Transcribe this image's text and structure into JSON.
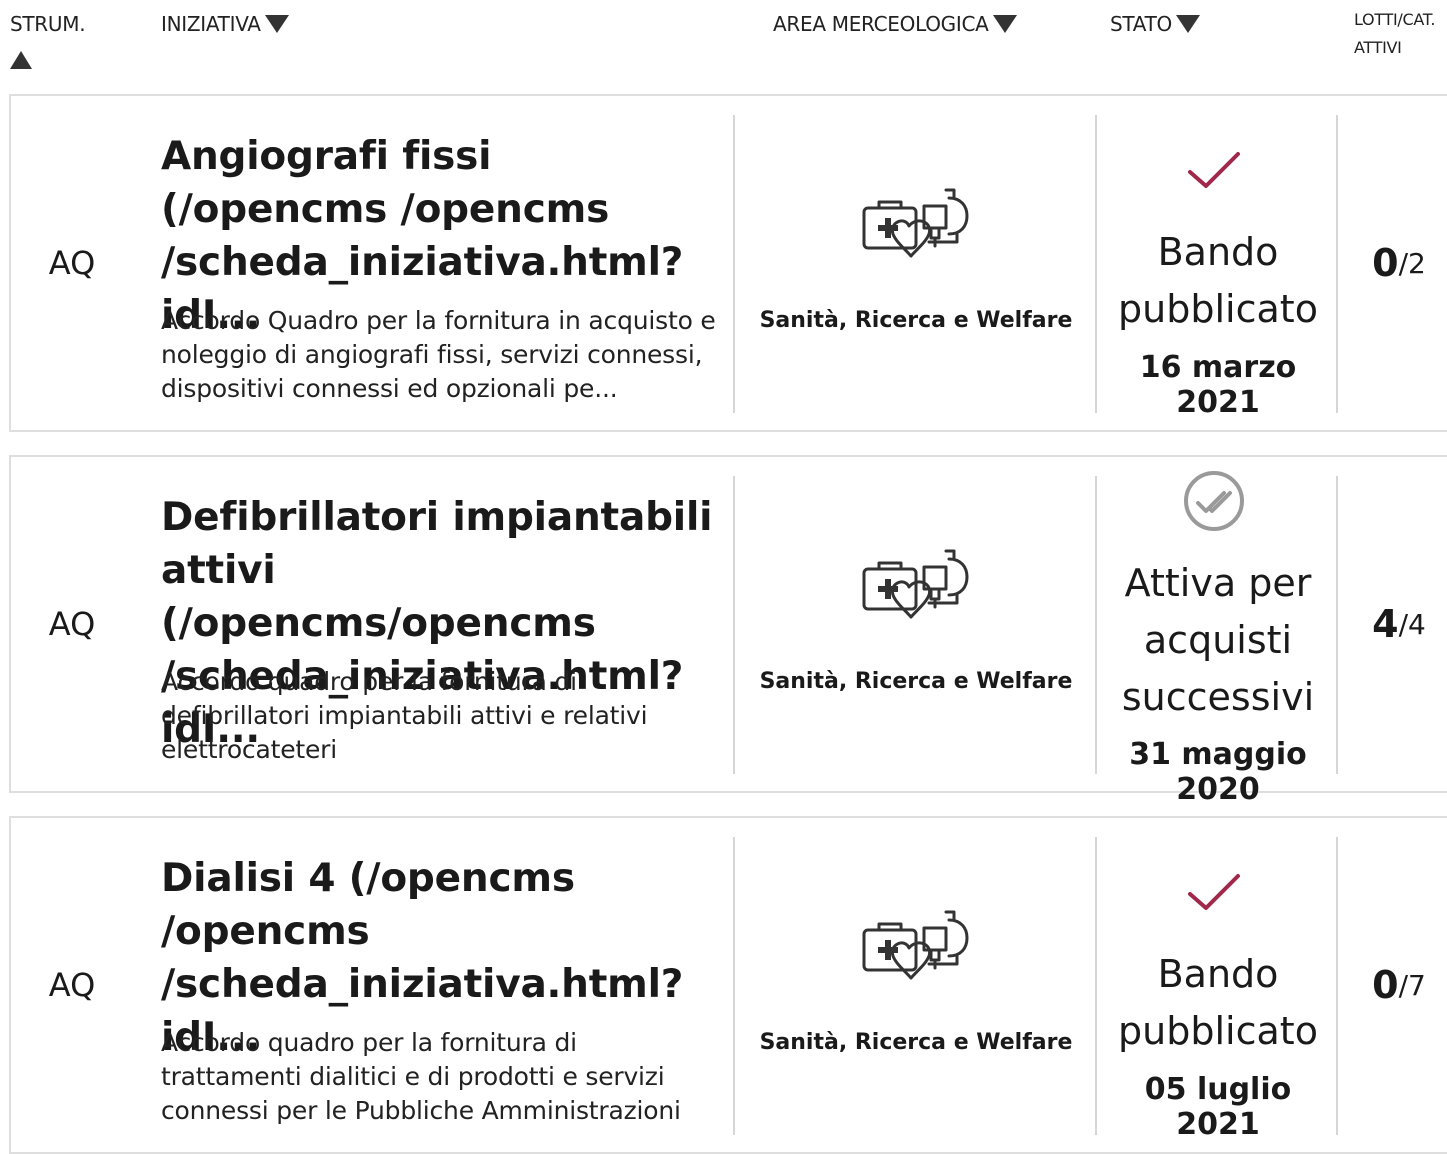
{
  "header": {
    "strum": "STRUM.",
    "iniziativa": "INIZIATIVA",
    "area": "AREA MERCEOLOGICA",
    "stato": "STATO",
    "lotti_line1": "LOTTI/CAT.",
    "lotti_line2": "ATTIVI"
  },
  "colors": {
    "check": "#a0284a",
    "grey_icon": "#9a9a9a",
    "border": "#dedede"
  },
  "rows": [
    {
      "strum": "AQ",
      "title": "Angiografi fissi (/opencms /opencms /scheda_iniziativa.html?idI...",
      "desc": "Accordo Quadro per la fornitura in acquisto e noleggio di angiografi fissi, servizi connessi, dispositivi connessi ed opzionali pe...",
      "area": "Sanità, Ricerca e Welfare",
      "area_icon": "medical-kit-heart-microscope-icon",
      "stato_icon": "check-icon",
      "stato_text": "Bando pubblicato",
      "stato_date": "16 marzo 2021",
      "lotti_active": "0",
      "lotti_total": "/2"
    },
    {
      "strum": "AQ",
      "title": "Defibrillatori impiantabili attivi (/opencms/opencms /scheda_iniziativa.html?idI...",
      "desc": "Accordo quadro per la fornitura di defibrillatori impiantabili attivi e relativi elettrocateteri",
      "area": "Sanità, Ricerca e Welfare",
      "area_icon": "medical-kit-heart-microscope-icon",
      "stato_icon": "double-check-circle-icon",
      "stato_text": "Attiva per acquisti successivi",
      "stato_date": "31 maggio 2020",
      "lotti_active": "4",
      "lotti_total": "/4"
    },
    {
      "strum": "AQ",
      "title": "Dialisi 4 (/opencms /opencms /scheda_iniziativa.html?idI...",
      "desc": "Accordo quadro per la fornitura di trattamenti dialitici e di prodotti e servizi connessi per le Pubbliche Amministrazioni",
      "area": "Sanità, Ricerca e Welfare",
      "area_icon": "medical-kit-heart-microscope-icon",
      "stato_icon": "check-icon",
      "stato_text": "Bando pubblicato",
      "stato_date": "05 luglio 2021",
      "lotti_active": "0",
      "lotti_total": "/7"
    }
  ]
}
